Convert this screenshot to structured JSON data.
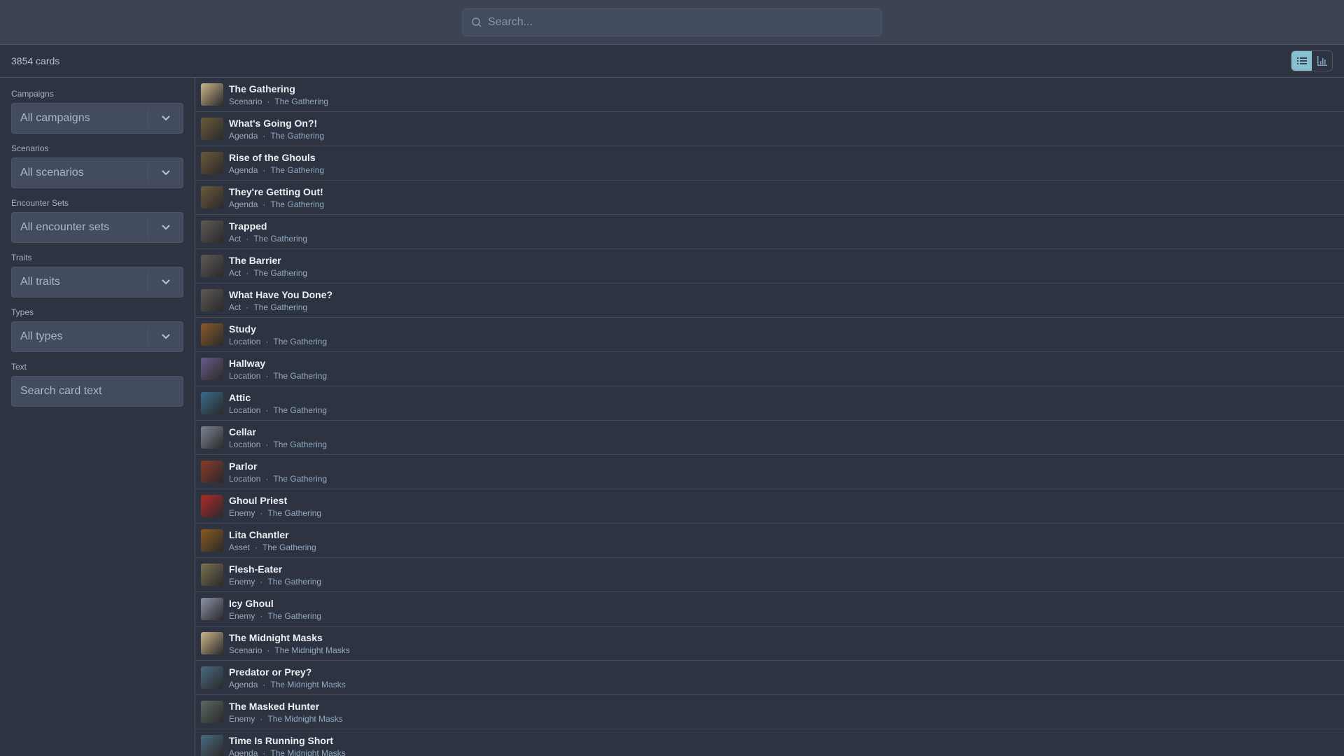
{
  "search": {
    "placeholder": "Search..."
  },
  "count": "3854 cards",
  "filters": {
    "campaigns": {
      "label": "Campaigns",
      "value": "All campaigns"
    },
    "scenarios": {
      "label": "Scenarios",
      "value": "All scenarios"
    },
    "encounter_sets": {
      "label": "Encounter Sets",
      "value": "All encounter sets"
    },
    "traits": {
      "label": "Traits",
      "value": "All traits"
    },
    "types": {
      "label": "Types",
      "value": "All types"
    },
    "text": {
      "label": "Text",
      "placeholder": "Search card text"
    }
  },
  "colors": {
    "accent": "#88c0d0"
  },
  "cards": [
    {
      "name": "The Gathering",
      "type": "Scenario",
      "set": "The Gathering",
      "c": "#c9b58a"
    },
    {
      "name": "What's Going On?!",
      "type": "Agenda",
      "set": "The Gathering",
      "c": "#6b5a3a"
    },
    {
      "name": "Rise of the Ghouls",
      "type": "Agenda",
      "set": "The Gathering",
      "c": "#6b5a3a"
    },
    {
      "name": "They're Getting Out!",
      "type": "Agenda",
      "set": "The Gathering",
      "c": "#6b5a3a"
    },
    {
      "name": "Trapped",
      "type": "Act",
      "set": "The Gathering",
      "c": "#5e5a55"
    },
    {
      "name": "The Barrier",
      "type": "Act",
      "set": "The Gathering",
      "c": "#5e5a55"
    },
    {
      "name": "What Have You Done?",
      "type": "Act",
      "set": "The Gathering",
      "c": "#5e5a55"
    },
    {
      "name": "Study",
      "type": "Location",
      "set": "The Gathering",
      "c": "#8a5a2a"
    },
    {
      "name": "Hallway",
      "type": "Location",
      "set": "The Gathering",
      "c": "#6a5a8a"
    },
    {
      "name": "Attic",
      "type": "Location",
      "set": "The Gathering",
      "c": "#3a6a8a"
    },
    {
      "name": "Cellar",
      "type": "Location",
      "set": "The Gathering",
      "c": "#7a8590"
    },
    {
      "name": "Parlor",
      "type": "Location",
      "set": "The Gathering",
      "c": "#8a3a2a"
    },
    {
      "name": "Ghoul Priest",
      "type": "Enemy",
      "set": "The Gathering",
      "c": "#b02a2a"
    },
    {
      "name": "Lita Chantler",
      "type": "Asset",
      "set": "The Gathering",
      "c": "#8a5a20"
    },
    {
      "name": "Flesh-Eater",
      "type": "Enemy",
      "set": "The Gathering",
      "c": "#7a7050"
    },
    {
      "name": "Icy Ghoul",
      "type": "Enemy",
      "set": "The Gathering",
      "c": "#8a90a8"
    },
    {
      "name": "The Midnight Masks",
      "type": "Scenario",
      "set": "The Midnight Masks",
      "c": "#c9b58a"
    },
    {
      "name": "Predator or Prey?",
      "type": "Agenda",
      "set": "The Midnight Masks",
      "c": "#4a6a80"
    },
    {
      "name": "The Masked Hunter",
      "type": "Enemy",
      "set": "The Midnight Masks",
      "c": "#5a6a60"
    },
    {
      "name": "Time Is Running Short",
      "type": "Agenda",
      "set": "The Midnight Masks",
      "c": "#4a6a80"
    }
  ]
}
